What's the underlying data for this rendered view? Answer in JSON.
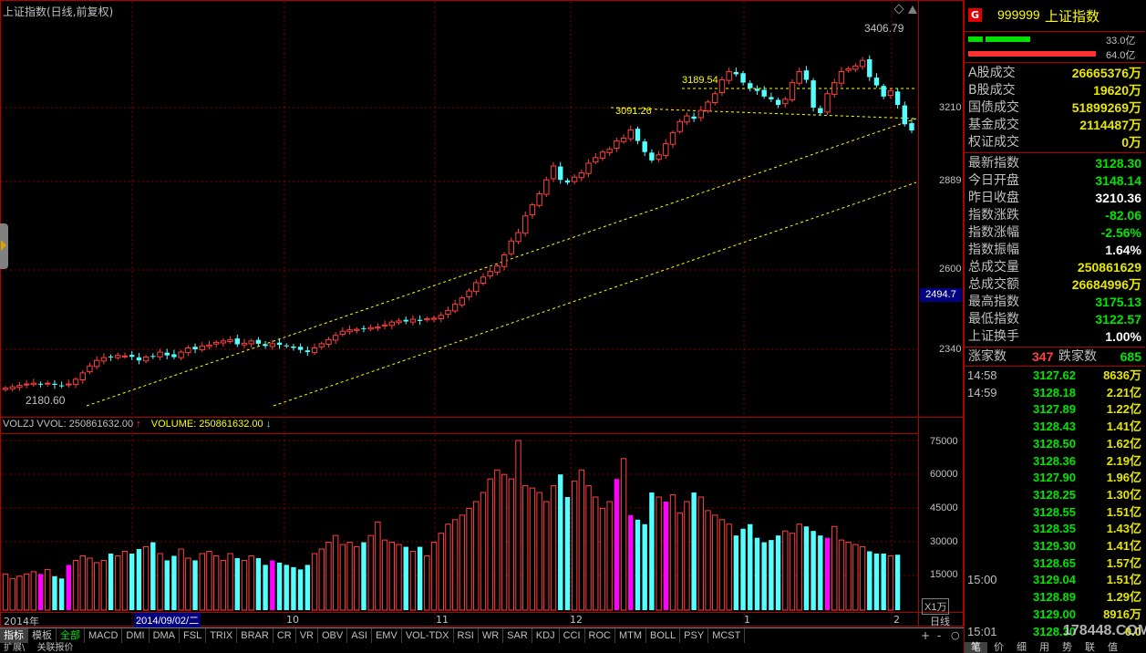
{
  "chart": {
    "title": "上证指数(日线,前复权)",
    "hi_label": "3406.79",
    "lo_label": "2180.60",
    "level_label_1": "3189.54",
    "level_label_2": "3091.26",
    "price_axis": [
      "3210",
      "2889",
      "2600",
      "2340"
    ],
    "current_price_tag": "2494.7",
    "vol_title": "VOLZJ VVOL: 250861632.00",
    "vol_title_2": "VOLUME: 250861632.00",
    "vol_axis": [
      "75000",
      "60000",
      "45000",
      "30000",
      "15000"
    ],
    "vol_unit": "X1万",
    "x_labels": [
      "2014年",
      "10",
      "11",
      "12",
      "1",
      "2"
    ],
    "date_tag": "2014/09/02/二",
    "period": "日线",
    "colors": {
      "up": "#ff4040",
      "down": "#54ffff",
      "hilite": "#ff00ff",
      "grid": "#800000",
      "dash": "#ffff00"
    }
  },
  "tabs": [
    "指标",
    "模板",
    "全部",
    "MACD",
    "DMI",
    "DMA",
    "FSL",
    "TRIX",
    "BRAR",
    "CR",
    "VR",
    "OBV",
    "ASI",
    "EMV",
    "VOL-TDX",
    "RSI",
    "WR",
    "SAR",
    "KDJ",
    "CCI",
    "ROC",
    "MTM",
    "BOLL",
    "PSY",
    "MCST"
  ],
  "bottom_left": [
    "扩展\\",
    "关联报价"
  ],
  "nav_buttons": [
    "+",
    "-",
    "○"
  ],
  "panel": {
    "code_badge": "G",
    "code": "999999",
    "name": "上证指数",
    "bar1_label": "33.0亿",
    "bar2_label": "64.0亿",
    "stats_a": [
      {
        "label": "A股成交",
        "value": "26665376万"
      },
      {
        "label": "B股成交",
        "value": "19620万"
      },
      {
        "label": "国债成交",
        "value": "51899269万"
      },
      {
        "label": "基金成交",
        "value": "2114487万"
      },
      {
        "label": "权证成交",
        "value": "0万"
      }
    ],
    "stats_b": [
      {
        "label": "最新指数",
        "value": "3128.30",
        "color": "#00e600"
      },
      {
        "label": "今日开盘",
        "value": "3148.14",
        "color": "#00e600"
      },
      {
        "label": "昨日收盘",
        "value": "3210.36",
        "color": "#ffffff"
      },
      {
        "label": "指数涨跌",
        "value": "-82.06",
        "color": "#00e600"
      },
      {
        "label": "指数涨幅",
        "value": "-2.56%",
        "color": "#00e600"
      },
      {
        "label": "指数振幅",
        "value": "1.64%",
        "color": "#ffffff"
      },
      {
        "label": "总成交量",
        "value": "250861629",
        "color": "#e6e600"
      },
      {
        "label": "总成交额",
        "value": "26684996万",
        "color": "#e6e600"
      },
      {
        "label": "最高指数",
        "value": "3175.13",
        "color": "#00e600"
      },
      {
        "label": "最低指数",
        "value": "3122.57",
        "color": "#00e600"
      },
      {
        "label": "上证换手",
        "value": "1.00%",
        "color": "#ffffff"
      }
    ],
    "rise_label": "涨家数",
    "rise_value": "347",
    "fall_label": "跌家数",
    "fall_value": "685",
    "ticks": [
      {
        "time": "14:58",
        "price": "3127.62",
        "vol": "8636万"
      },
      {
        "time": "14:59",
        "price": "3128.18",
        "vol": "2.21亿"
      },
      {
        "time": "",
        "price": "3127.89",
        "vol": "1.22亿"
      },
      {
        "time": "",
        "price": "3128.43",
        "vol": "1.41亿"
      },
      {
        "time": "",
        "price": "3128.50",
        "vol": "1.62亿"
      },
      {
        "time": "",
        "price": "3128.36",
        "vol": "2.19亿"
      },
      {
        "time": "",
        "price": "3127.90",
        "vol": "1.96亿"
      },
      {
        "time": "",
        "price": "3128.25",
        "vol": "1.30亿"
      },
      {
        "time": "",
        "price": "3128.55",
        "vol": "1.51亿"
      },
      {
        "time": "",
        "price": "3128.35",
        "vol": "1.43亿"
      },
      {
        "time": "",
        "price": "3129.30",
        "vol": "1.41亿"
      },
      {
        "time": "",
        "price": "3128.65",
        "vol": "1.57亿"
      },
      {
        "time": "15:00",
        "price": "3129.04",
        "vol": "1.51亿"
      },
      {
        "time": "",
        "price": "3128.89",
        "vol": "1.29亿"
      },
      {
        "time": "",
        "price": "3129.00",
        "vol": "8916万"
      },
      {
        "time": "15:01",
        "price": "3128.30",
        "vol": "0.0"
      }
    ],
    "bottom_tabs": [
      "笔",
      "价",
      "细",
      "用",
      "势",
      "联",
      "值"
    ],
    "watermark": "178448.COM"
  },
  "chart_data": {
    "type": "candlestick",
    "title": "上证指数(日线,前复权)",
    "closes": [
      2200,
      2205,
      2210,
      2215,
      2218,
      2213,
      2218,
      2212,
      2208,
      2215,
      2232,
      2255,
      2280,
      2300,
      2310,
      2312,
      2318,
      2316,
      2313,
      2300,
      2312,
      2315,
      2330,
      2318,
      2312,
      2330,
      2345,
      2340,
      2352,
      2355,
      2365,
      2370,
      2375,
      2358,
      2362,
      2370,
      2360,
      2352,
      2360,
      2356,
      2352,
      2345,
      2338,
      2330,
      2345,
      2360,
      2375,
      2390,
      2405,
      2410,
      2412,
      2415,
      2418,
      2420,
      2428,
      2438,
      2442,
      2440,
      2448,
      2442,
      2450,
      2452,
      2462,
      2480,
      2502,
      2525,
      2550,
      2580,
      2600,
      2620,
      2640,
      2680,
      2730,
      2760,
      2820,
      2860,
      2900,
      2950,
      3000,
      2950,
      2940,
      2960,
      2975,
      3010,
      3030,
      3050,
      3060,
      3090,
      3100,
      3130,
      3090,
      3050,
      3020,
      3040,
      3080,
      3120,
      3160,
      3180,
      3170,
      3200,
      3230,
      3260,
      3310,
      3340,
      3330,
      3300,
      3280,
      3270,
      3250,
      3240,
      3220,
      3240,
      3300,
      3340,
      3310,
      3210,
      3190,
      3260,
      3300,
      3340,
      3350,
      3360,
      3380,
      3320,
      3290,
      3250,
      3270,
      3220,
      3150,
      3128
    ],
    "volumes": [
      16000,
      14000,
      15000,
      16000,
      17000,
      16000,
      18000,
      15000,
      14000,
      20000,
      22000,
      24000,
      23000,
      21000,
      22000,
      25000,
      24000,
      26000,
      25000,
      27000,
      28000,
      30000,
      25000,
      22000,
      24000,
      27000,
      23000,
      22000,
      25000,
      26000,
      24000,
      22000,
      25000,
      23000,
      22000,
      24000,
      23000,
      20000,
      22000,
      21000,
      20000,
      19000,
      18000,
      20000,
      25000,
      27000,
      30000,
      33000,
      29000,
      30000,
      28000,
      30000,
      33000,
      39000,
      31000,
      30000,
      29000,
      28000,
      26000,
      28000,
      24000,
      30000,
      34000,
      38000,
      40000,
      42000,
      45000,
      48000,
      52000,
      58000,
      62000,
      60000,
      58000,
      75000,
      55000,
      54000,
      52000,
      48000,
      55000,
      60000,
      50000,
      57000,
      62000,
      55000,
      50000,
      45000,
      48000,
      58000,
      67000,
      42000,
      40000,
      38000,
      52000,
      50000,
      48000,
      51000,
      43000,
      48000,
      52000,
      50000,
      44000,
      42000,
      40000,
      38000,
      33000,
      36000,
      38000,
      32000,
      30000,
      31000,
      33000,
      35000,
      34000,
      38000,
      37000,
      35000,
      33000,
      32000,
      37000,
      31000,
      30000,
      29000,
      28000,
      26000,
      25000,
      25000,
      24000,
      24500
    ]
  }
}
